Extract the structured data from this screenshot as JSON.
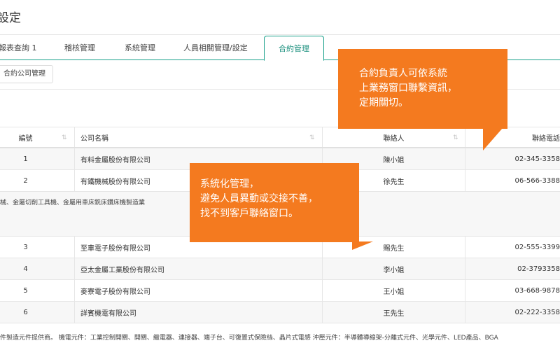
{
  "page": {
    "title": "設定"
  },
  "tabs": [
    {
      "label": "報表查詢 1"
    },
    {
      "label": "稽核管理"
    },
    {
      "label": "系統管理"
    },
    {
      "label": "人員相關管理/設定"
    },
    {
      "label": "合約管理"
    }
  ],
  "subtab": {
    "label": "合約公司管理"
  },
  "table": {
    "headers": {
      "num": "編號",
      "company": "公司名稱",
      "contact": "聯絡人",
      "phone": "聯絡電話"
    },
    "rows_top": [
      {
        "num": "1",
        "company": "有料金屬股份有限公司",
        "contact": "陳小姐",
        "phone": "02-345-3358"
      },
      {
        "num": "2",
        "company": "有鐵機械股份有限公司",
        "contact": "徐先生",
        "phone": "06-566-3388"
      }
    ],
    "description_1": "械、金屬切削工具機、金屬用車床銑床鑽床機製造業",
    "rows_bottom": [
      {
        "num": "3",
        "company": "至車電子股份有限公司",
        "contact": "賜先生",
        "phone": "02-555-3399"
      },
      {
        "num": "4",
        "company": "亞太金屬工業股份有限公司",
        "contact": "李小姐",
        "phone": "02-3793358"
      },
      {
        "num": "5",
        "company": "麥寮電子股份有限公司",
        "contact": "王小姐",
        "phone": "03-668-9878"
      },
      {
        "num": "6",
        "company": "詳賓機電有限公司",
        "contact": "王先生",
        "phone": "02-222-3358"
      }
    ],
    "description_2": "件製造元件提供商。 機電元件：工業控制開關、開關、繼電器、連接器、端子台、可復置式保險絲、晶片式電感 沖壓元件：半導體導線架-分離式元件、光學元件、LED產品、BGA"
  },
  "callouts": {
    "top": {
      "lines": [
        "合約負責人可依系統",
        "上業務窗口聯繫資訊，",
        "定期關切。"
      ]
    },
    "middle": {
      "lines": [
        "系統化管理，",
        "避免人員異動或交接不善，",
        "找不到客戶聯絡窗口。"
      ]
    }
  },
  "colors": {
    "accent": "#19a08a",
    "callout": "#f47a1f"
  }
}
